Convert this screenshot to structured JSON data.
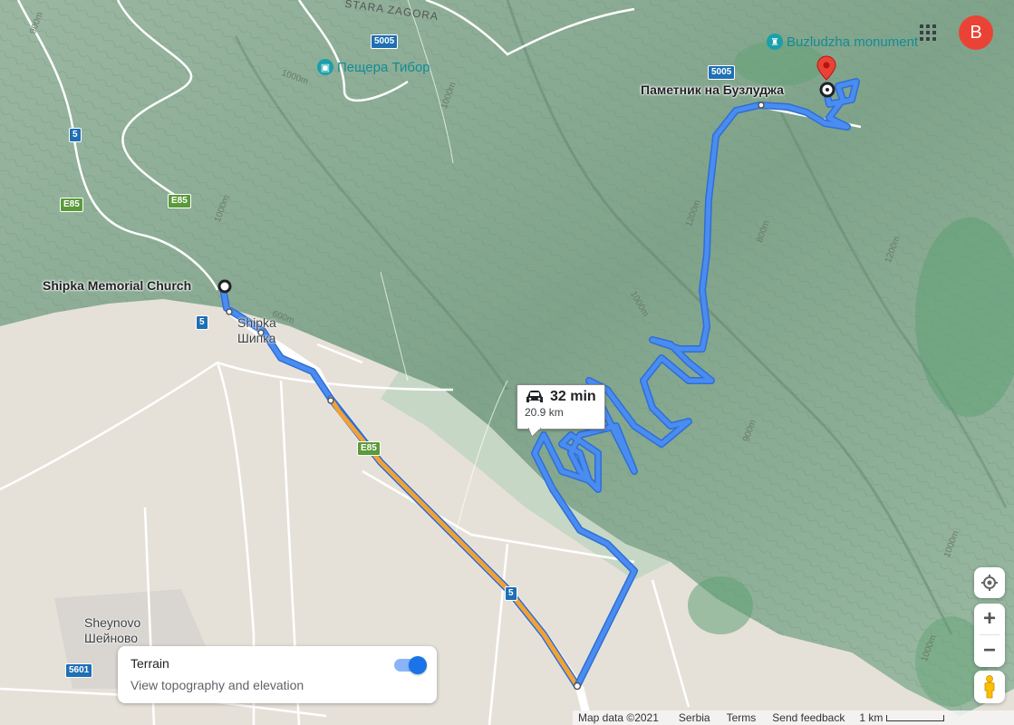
{
  "route": {
    "duration": "32 min",
    "distance": "20.9 km"
  },
  "places": {
    "origin": "Shipka Memorial Church",
    "destination": "Паметник на Бузлуджа",
    "town_shipka_latin": "Shipka",
    "town_shipka_cyrillic": "Шипка",
    "town_sheynovo_latin": "Sheynovo",
    "town_sheynovo_cyrillic": "Шейново",
    "region": "STARA ZAGORA"
  },
  "pois": {
    "cave": "Пещера Тибор",
    "monument": "Buzludzha monument"
  },
  "roads": {
    "r5005_a": "5005",
    "r5005_b": "5005",
    "r5_a": "5",
    "r5_b": "5",
    "r5_c": "5",
    "e85_a": "E85",
    "e85_b": "E85",
    "e85_c": "E85",
    "r5601": "5601"
  },
  "elevations": {
    "e1": "900m",
    "e2": "1000m",
    "e3": "1000m",
    "e4": "1000m",
    "e5": "1200m",
    "e6": "1000m",
    "e7": "1200m",
    "e8": "900m",
    "e9": "1000m",
    "e10": "1000m",
    "e11": "600m",
    "e12": "800m"
  },
  "terrain_panel": {
    "title": "Terrain",
    "subtitle": "View topography and elevation",
    "toggle_on": true
  },
  "account": {
    "avatar_letter": "B",
    "avatar_color": "#ea4335"
  },
  "footer": {
    "map_data": "Map data ©2021",
    "country": "Serbia",
    "terms": "Terms",
    "feedback": "Send feedback",
    "scale": "1 km"
  },
  "colors": {
    "route_blue": "#4a8cf0",
    "traffic_orange": "#f2a233",
    "terrain_green": "#8fb89a",
    "plain": "#e6e1d8",
    "accent": "#1a73e8"
  },
  "icons": {
    "apps": "apps-grid-icon",
    "car": "car-icon",
    "destination": "destination-pin-icon",
    "location": "my-location-icon",
    "pegman": "pegman-icon"
  }
}
